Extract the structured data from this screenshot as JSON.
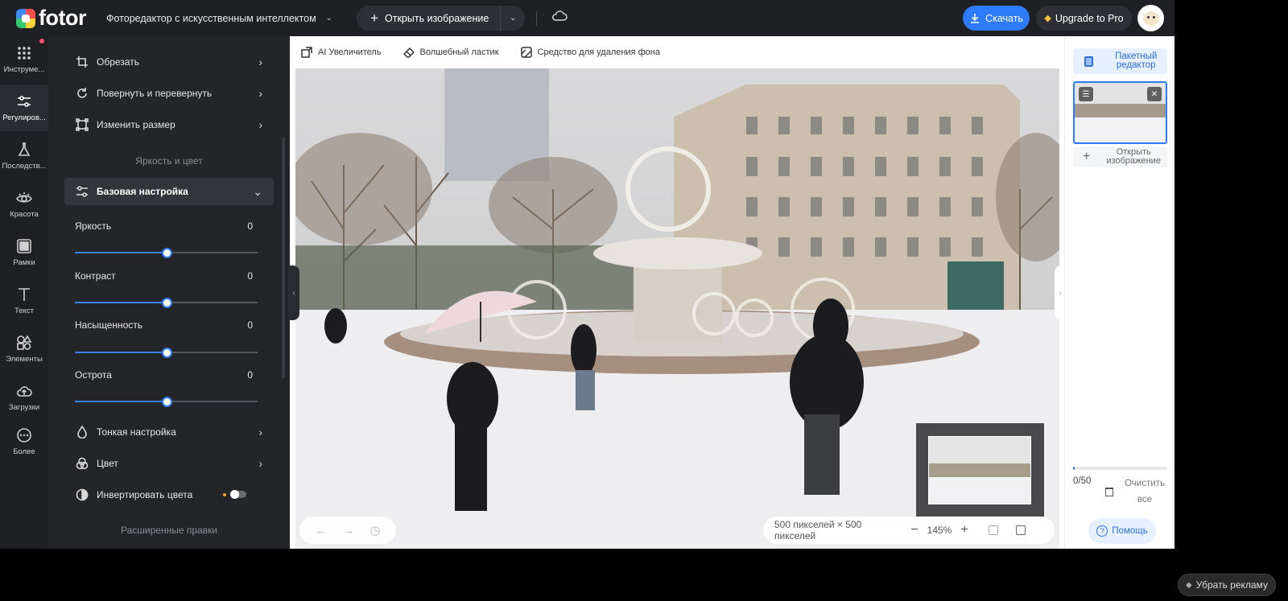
{
  "header": {
    "logo_text": "fotor",
    "ai_editor_label": "Фоторедактор с искусственным интеллектом",
    "open_image_label": "Открыть изображение",
    "download_label": "Скачать",
    "upgrade_label": "Upgrade to Pro"
  },
  "rail": {
    "items": [
      {
        "label": "Инструме...",
        "icon": "grid-icon"
      },
      {
        "label": "Регулиров...",
        "icon": "sliders-icon"
      },
      {
        "label": "Последств...",
        "icon": "flask-icon"
      },
      {
        "label": "Красота",
        "icon": "eye-icon"
      },
      {
        "label": "Рамки",
        "icon": "frame-icon"
      },
      {
        "label": "Текст",
        "icon": "text-icon"
      },
      {
        "label": "Элементы",
        "icon": "shapes-icon"
      },
      {
        "label": "Загрузки",
        "icon": "upload-cloud-icon"
      },
      {
        "label": "Более",
        "icon": "more-icon"
      }
    ]
  },
  "panel": {
    "crop_label": "Обрезать",
    "rotate_label": "Повернуть и перевернуть",
    "resize_label": "Изменить размер",
    "brightness_color_section": "Яркость и цвет",
    "basic_label": "Базовая настройка",
    "sliders": [
      {
        "label": "Яркость",
        "value": "0",
        "level": 0.5
      },
      {
        "label": "Контраст",
        "value": "0",
        "level": 0.5
      },
      {
        "label": "Насыщенность",
        "value": "0",
        "level": 0.5
      },
      {
        "label": "Острота",
        "value": "0",
        "level": 0.5
      }
    ],
    "fine_tune_label": "Тонкая настройка",
    "color_label": "Цвет",
    "invert_label": "Инвертировать цвета",
    "advanced_section": "Расширенные правки"
  },
  "toolbar": {
    "upscaler_label": "AI Увеличитель",
    "eraser_label": "Волшебный ластик",
    "bg_remover_label": "Средство для удаления фона"
  },
  "canvas": {
    "dimensions_label": "500 пикселей × 500 пикселей",
    "zoom_label": "145%"
  },
  "right_panel": {
    "batch_label": "Пакетный редактор",
    "add_image_label": "Открыть изображение",
    "count_label": "0/50",
    "clear_label": "Очистить все",
    "help_label": "Помощь",
    "progress": 0.0
  },
  "ads": {
    "remove_label": "Убрать рекламу"
  },
  "colors": {
    "accent": "#2f7bff",
    "dark_bg": "#1f2024",
    "panel_bg": "#242529"
  }
}
